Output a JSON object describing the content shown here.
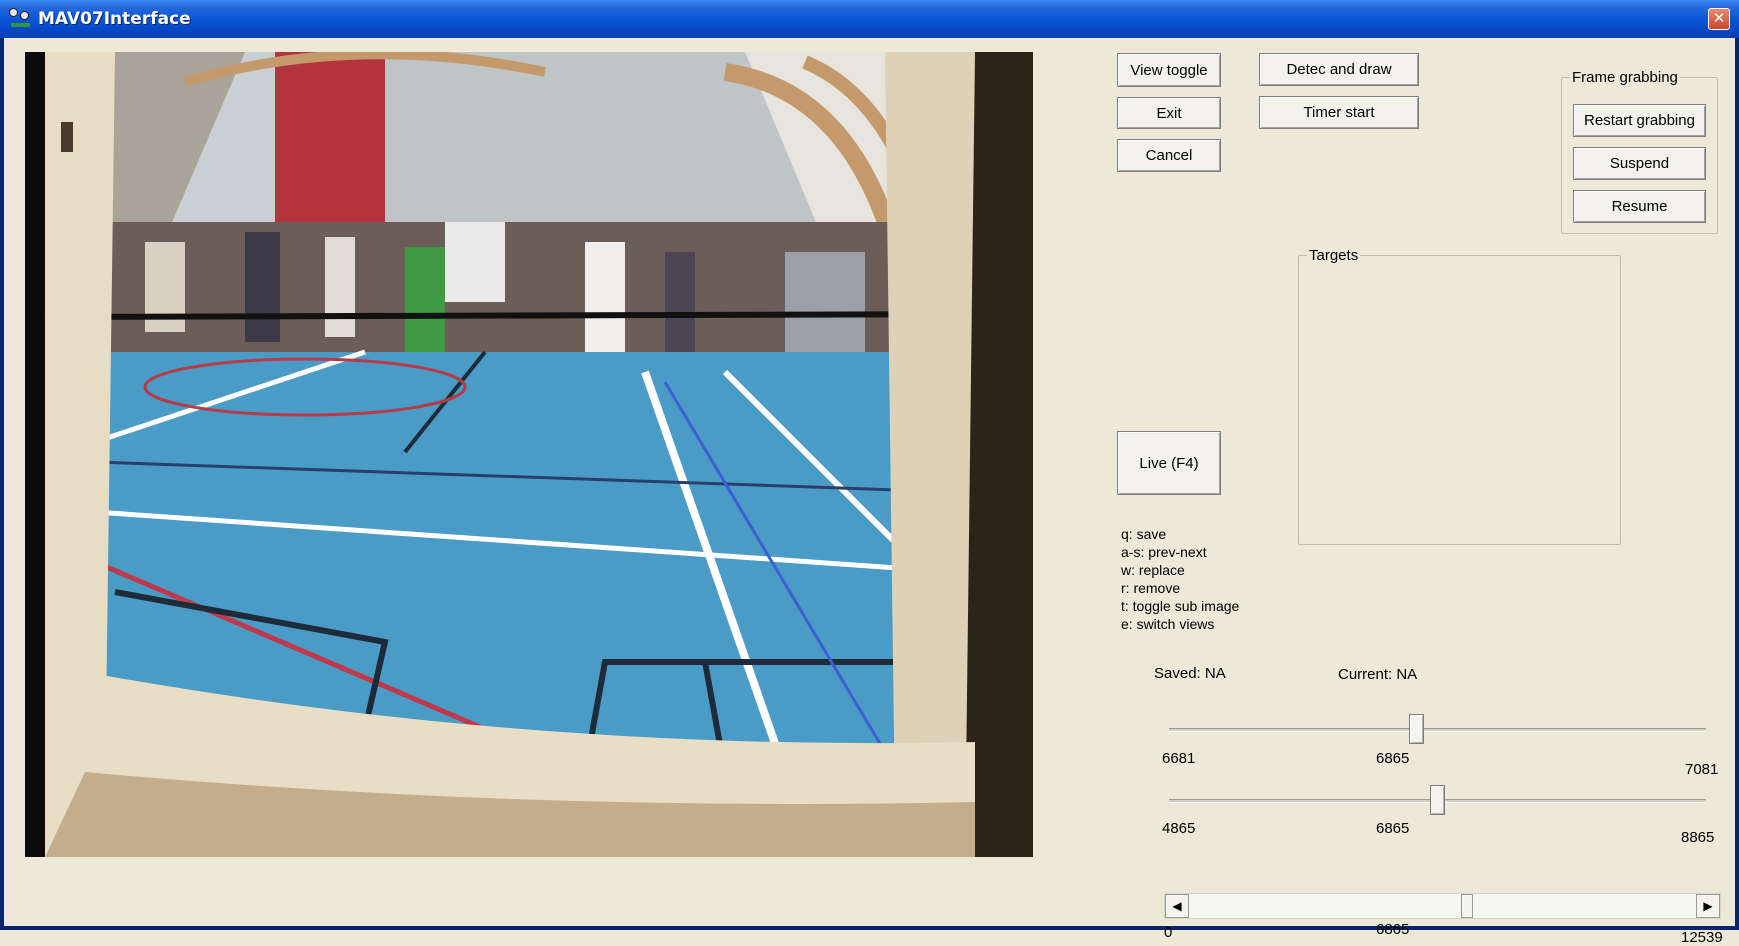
{
  "window": {
    "title": "MAV07Interface",
    "close_glyph": "✕"
  },
  "buttons": {
    "view_toggle": "View toggle",
    "exit": "Exit",
    "cancel": "Cancel",
    "detect_and_draw": "Detec and draw",
    "timer_start": "Timer start",
    "live": "Live (F4)"
  },
  "frame_grabbing": {
    "legend": "Frame grabbing",
    "restart": "Restart grabbing",
    "suspend": "Suspend",
    "resume": "Resume"
  },
  "targets": {
    "legend": "Targets"
  },
  "help_lines": [
    "q: save",
    "a-s: prev-next",
    "w: replace",
    "r: remove",
    "t: toggle sub image",
    "e: switch views"
  ],
  "status": {
    "saved": "Saved: NA",
    "current": "Current: NA"
  },
  "slider1": {
    "min": "6681",
    "value": "6865",
    "max": "7081",
    "fraction": 0.46
  },
  "slider2": {
    "min": "4865",
    "value": "6865",
    "max": "8865",
    "fraction": 0.5
  },
  "scrollbar": {
    "min": "0",
    "value": "6865",
    "max": "12539",
    "fraction": 0.5475,
    "left_arrow": "◀",
    "right_arrow": "▶"
  },
  "colors": {
    "title_bar": "#0a55d6",
    "court_floor": "#4a9bc6",
    "court_lines": "#ffffff",
    "window_bg": "#ece9d8"
  },
  "video": {
    "description_icon": "camera-feed-image"
  }
}
